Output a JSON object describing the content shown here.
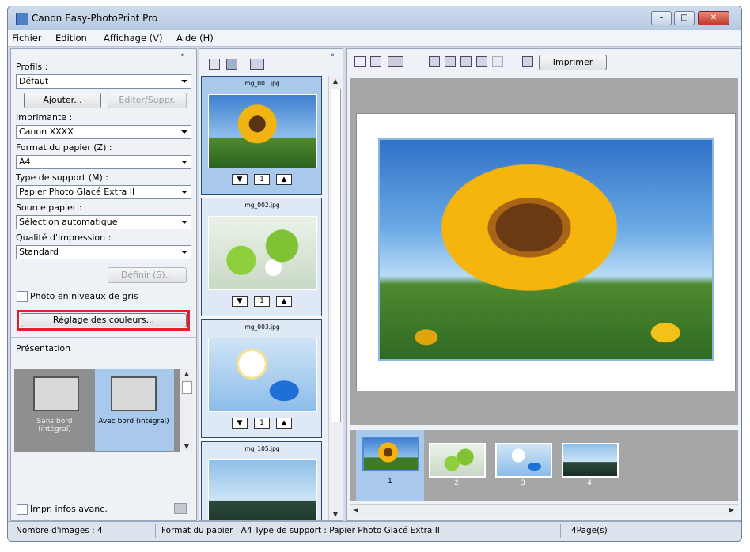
{
  "window": {
    "title": "Canon Easy-PhotoPrint Pro"
  },
  "menu": [
    "Fichier",
    "Edition",
    "Affichage (V)",
    "Aide (H)"
  ],
  "settings": {
    "profile_label": "Profils :",
    "profile_value": "Défaut",
    "add_button": "Ajouter...",
    "edit_button": "Editer/Suppr.",
    "printer_label": "Imprimante :",
    "printer_value": "Canon XXXX",
    "paper_size_label": "Format du papier (Z) :",
    "paper_size_value": "A4",
    "media_type_label": "Type de support (M) :",
    "media_type_value": "Papier Photo Glacé Extra II",
    "paper_source_label": "Source papier :",
    "paper_source_value": "Sélection automatique",
    "print_quality_label": "Qualité d'impression :",
    "print_quality_value": "Standard",
    "define_button": "Définir (S)...",
    "grayscale_label": "Photo en niveaux de gris",
    "color_adjust_button": "Réglage des couleurs...",
    "layout_label": "Présentation",
    "layouts": [
      {
        "name": "Sans bord (intégral)"
      },
      {
        "name": "Avec bord (intégral)"
      }
    ],
    "advanced_info_label": "Impr. infos avanc."
  },
  "thumbnails": [
    {
      "file": "img_001.jpg",
      "copies": "1"
    },
    {
      "file": "img_002.jpg",
      "copies": "1"
    },
    {
      "file": "img_003.jpg",
      "copies": "1"
    },
    {
      "file": "img_105.jpg"
    }
  ],
  "toolbar": {
    "print_button": "Imprimer"
  },
  "pages": [
    "1",
    "2",
    "3",
    "4"
  ],
  "status": {
    "image_count": "Nombre d'images : 4",
    "paper_info": "Format du papier : A4  Type de support : Papier Photo Glacé Extra II",
    "pages": "4Page(s)"
  },
  "colors": {
    "highlight_border": "#e2202b",
    "selection": "#a9c9ec"
  }
}
